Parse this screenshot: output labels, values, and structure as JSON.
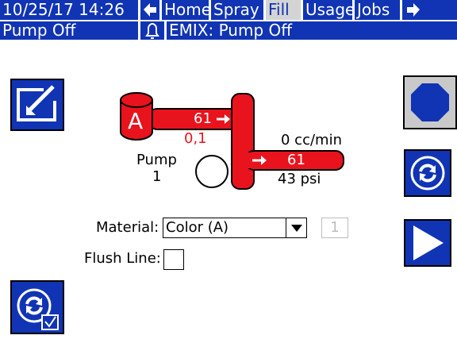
{
  "header": {
    "datetime": "10/25/17 14:26",
    "tabs": [
      {
        "label": "Home"
      },
      {
        "label": "Spray"
      },
      {
        "label": "Fill"
      },
      {
        "label": "Usage"
      },
      {
        "label": "Jobs"
      }
    ],
    "active_tab": "Fill",
    "status": "Pump Off",
    "alarm_message": "EMIX: Pump Off"
  },
  "diagram": {
    "tank_label": "A",
    "inlet_flow": "61",
    "inlet_sub": "0,1",
    "pump_label": "Pump",
    "pump_number": "1",
    "flow_rate": "0 cc/min",
    "outlet_value": "61",
    "pressure": "43 psi"
  },
  "form": {
    "material_label": "Material:",
    "material_value": "Color (A)",
    "material_index": "1",
    "flush_label": "Flush Line:",
    "flush_checked": false
  },
  "colors": {
    "header_blue": "#1034b4",
    "fluid_red": "#e8131d",
    "button_grey": "#c9c9c9"
  },
  "icons": [
    "back-arrow-icon",
    "forward-arrow-icon",
    "bell-icon",
    "edit-icon",
    "stop-icon",
    "cycle-icon",
    "play-icon",
    "cycle-check-icon"
  ]
}
